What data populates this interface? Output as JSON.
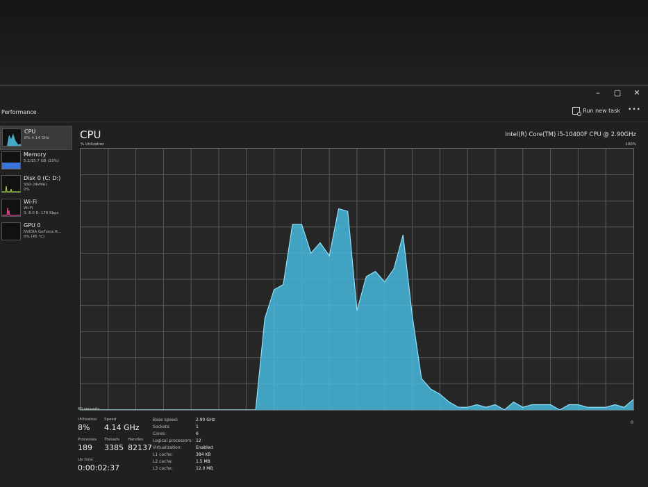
{
  "window": {
    "controls": {
      "minimize": "–",
      "maximize": "▢",
      "close": "✕"
    }
  },
  "header": {
    "title": "Performance",
    "run_new_task": "Run new task",
    "more": "•••"
  },
  "sidebar": {
    "items": [
      {
        "name": "CPU",
        "sub": "8% 4.14 GHz",
        "sub2": "",
        "color": "#4fc3e8",
        "active": true
      },
      {
        "name": "Memory",
        "sub": "5.2/15.7 GB (33%)",
        "sub2": "",
        "color": "#3b74d9",
        "active": false
      },
      {
        "name": "Disk 0 (C: D:)",
        "sub": "SSD (NVMe)",
        "sub2": "0%",
        "color": "#9cd03a",
        "active": false
      },
      {
        "name": "Wi-Fi",
        "sub": "Wi-Fi",
        "sub2": "S: 8.0  R: 176 Kbps",
        "color": "#d2478f",
        "active": false
      },
      {
        "name": "GPU 0",
        "sub": "NVIDIA GeForce R...",
        "sub2": "0% (45 °C)",
        "color": "#9a9a9a",
        "active": false
      }
    ]
  },
  "main": {
    "title": "CPU",
    "model": "Intel(R) Core(TM) i5-10400F CPU @ 2.90GHz",
    "util_label": "% Utilization",
    "max_label": "100%",
    "seconds_label": "60 seconds",
    "zero_label": "0"
  },
  "chart_data": {
    "type": "area",
    "x": [
      0,
      1,
      2,
      3,
      4,
      5,
      6,
      7,
      8,
      9,
      10,
      11,
      12,
      13,
      14,
      15,
      16,
      17,
      18,
      19,
      20,
      21,
      22,
      23,
      24,
      25,
      26,
      27,
      28,
      29,
      30,
      31,
      32,
      33,
      34,
      35,
      36,
      37,
      38,
      39,
      40,
      41,
      42,
      43,
      44,
      45,
      46,
      47,
      48,
      49,
      50,
      51,
      52,
      53,
      54,
      55,
      56,
      57,
      58,
      59,
      60
    ],
    "values": [
      0,
      0,
      0,
      0,
      0,
      0,
      0,
      0,
      0,
      0,
      0,
      0,
      0,
      0,
      0,
      0,
      0,
      0,
      0,
      0,
      35,
      46,
      48,
      71,
      71,
      60,
      64,
      59,
      77,
      76,
      38,
      51,
      53,
      49,
      54,
      67,
      36,
      12,
      8,
      6,
      3,
      1,
      1,
      2,
      1,
      2,
      0,
      3,
      1,
      2,
      2,
      2,
      0,
      2,
      2,
      1,
      1,
      1,
      2,
      1,
      4
    ],
    "ylim": [
      0,
      100
    ],
    "color": "#48b8de",
    "grid": true
  },
  "stats": {
    "utilization": {
      "label": "Utilization",
      "value": "8%"
    },
    "speed": {
      "label": "Speed",
      "value": "4.14 GHz"
    },
    "processes": {
      "label": "Processes",
      "value": "189"
    },
    "threads": {
      "label": "Threads",
      "value": "3385"
    },
    "handles": {
      "label": "Handles",
      "value": "82137"
    },
    "uptime": {
      "label": "Up time",
      "value": "0:00:02:37"
    },
    "details": [
      {
        "key": "Base speed:",
        "value": "2.90 GHz"
      },
      {
        "key": "Sockets:",
        "value": "1"
      },
      {
        "key": "Cores:",
        "value": "6"
      },
      {
        "key": "Logical processors:",
        "value": "12"
      },
      {
        "key": "Virtualization:",
        "value": "Enabled"
      },
      {
        "key": "L1 cache:",
        "value": "384 KB"
      },
      {
        "key": "L2 cache:",
        "value": "1.5 MB"
      },
      {
        "key": "L3 cache:",
        "value": "12.0 MB"
      }
    ]
  }
}
